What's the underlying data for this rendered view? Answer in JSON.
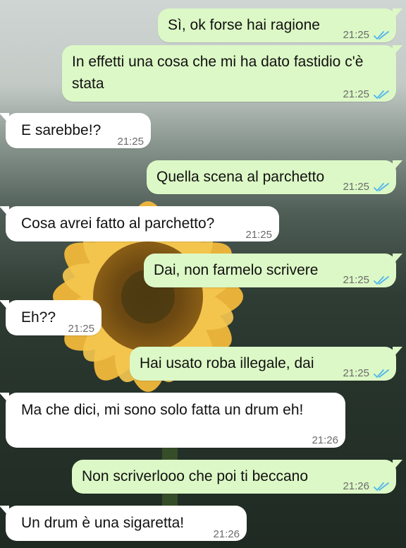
{
  "messages": [
    {
      "direction": "out",
      "text": "Sì, ok forse hai ragione",
      "time": "21:25",
      "status": "read"
    },
    {
      "direction": "out",
      "text": "In effetti una cosa che mi ha dato fastidio c'è stata",
      "time": "21:25",
      "status": "read"
    },
    {
      "direction": "in",
      "text": "E sarebbe!?",
      "time": "21:25"
    },
    {
      "direction": "out",
      "text": "Quella scena al parchetto",
      "time": "21:25",
      "status": "read"
    },
    {
      "direction": "in",
      "text": "Cosa avrei fatto al parchetto?",
      "time": "21:25"
    },
    {
      "direction": "out",
      "text": "Dai, non farmelo scrivere",
      "time": "21:25",
      "status": "read"
    },
    {
      "direction": "in",
      "text": "Eh??",
      "time": "21:25"
    },
    {
      "direction": "out",
      "text": "Hai usato roba illegale, dai",
      "time": "21:25",
      "status": "read"
    },
    {
      "direction": "in",
      "text": "Ma che dici, mi sono solo fatta un drum eh!",
      "time": "21:26"
    },
    {
      "direction": "out",
      "text": "Non scriverlooo che poi ti beccano",
      "time": "21:26",
      "status": "read"
    },
    {
      "direction": "in",
      "text": "Un drum è una sigaretta!",
      "time": "21:26"
    }
  ],
  "colors": {
    "outgoing_bubble": "#dcf8c6",
    "incoming_bubble": "#ffffff",
    "read_ticks": "#4fb6ec",
    "timestamp": "#6b6b6b"
  },
  "wallpaper_icon": "sunflower-wallpaper",
  "read_icon": "double-check-icon"
}
